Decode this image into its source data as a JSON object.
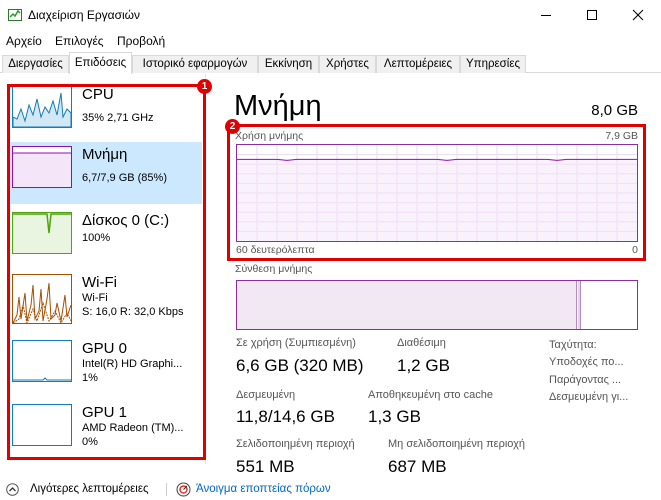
{
  "window": {
    "title": "Διαχείριση Εργασιών",
    "minimize_icon": "minimize-icon",
    "maximize_icon": "maximize-icon",
    "close_icon": "close-icon"
  },
  "menu": [
    "Αρχείο",
    "Επιλογές",
    "Προβολή"
  ],
  "tabs": [
    {
      "label": "Διεργασίες"
    },
    {
      "label": "Επιδόσεις",
      "active": true
    },
    {
      "label": "Ιστορικό εφαρμογών"
    },
    {
      "label": "Εκκίνηση"
    },
    {
      "label": "Χρήστες"
    },
    {
      "label": "Λεπτομέρειες"
    },
    {
      "label": "Υπηρεσίες"
    }
  ],
  "sidebar": {
    "items": [
      {
        "title": "CPU",
        "lines": [
          "35%  2,71 GHz"
        ],
        "color": "#117dbb"
      },
      {
        "title": "Μνήμη",
        "lines": [
          "6,7/7,9 GB (85%)"
        ],
        "color": "#8b12ae",
        "selected": true
      },
      {
        "title": "Δίσκος 0 (C:)",
        "lines": [
          "100%"
        ],
        "color": "#4da60c"
      },
      {
        "title": "Wi-Fi",
        "lines": [
          "Wi-Fi",
          "S: 16,0  R: 32,0 Kbps"
        ],
        "color": "#a74f01"
      },
      {
        "title": "GPU 0",
        "lines": [
          "Intel(R) HD Graphi...",
          "1%"
        ],
        "color": "#117dbb"
      },
      {
        "title": "GPU 1",
        "lines": [
          "AMD Radeon (TM)...",
          "0%"
        ],
        "color": "#117dbb"
      }
    ]
  },
  "memory": {
    "title": "Μνήμη",
    "capacity": "8,0 GB",
    "usage_label": "Χρήση μνήμης",
    "usage_max": "7,9 GB",
    "time_label": "60 δευτερόλεπτα",
    "time_zero": "0",
    "usage_level": 0.85,
    "composition_label": "Σύνθεση μνήμης",
    "composition_used_fraction": 0.85,
    "stats": {
      "in_use_label": "Σε χρήση (Συμπιεσμένη)",
      "in_use_value": "6,6 GB (320 MB)",
      "available_label": "Διαθέσιμη",
      "available_value": "1,2 GB",
      "committed_label": "Δεσμευμένη",
      "committed_value": "11,8/14,6 GB",
      "cached_label": "Αποθηκευμένη στο cache",
      "cached_value": "1,3 GB",
      "paged_label": "Σελιδοποιημένη περιοχή",
      "paged_value": "551 MB",
      "nonpaged_label": "Μη σελιδοποιημένη περιοχή",
      "nonpaged_value": "687 MB"
    },
    "properties": [
      "Ταχύτητα:",
      "Υποδοχές πο...",
      "Παράγοντας ...",
      "Δεσμευμένη γι..."
    ]
  },
  "footer": {
    "fewer_details": "Λιγότερες λεπτομέρειες",
    "resource_monitor": "Άνοιγμα εποπτείας πόρων",
    "chevron_icon": "chevron-up-icon",
    "monitor_icon": "resource-monitor-icon"
  },
  "annotations": {
    "badge_1": "1",
    "badge_2": "2",
    "color": "#e00000"
  }
}
